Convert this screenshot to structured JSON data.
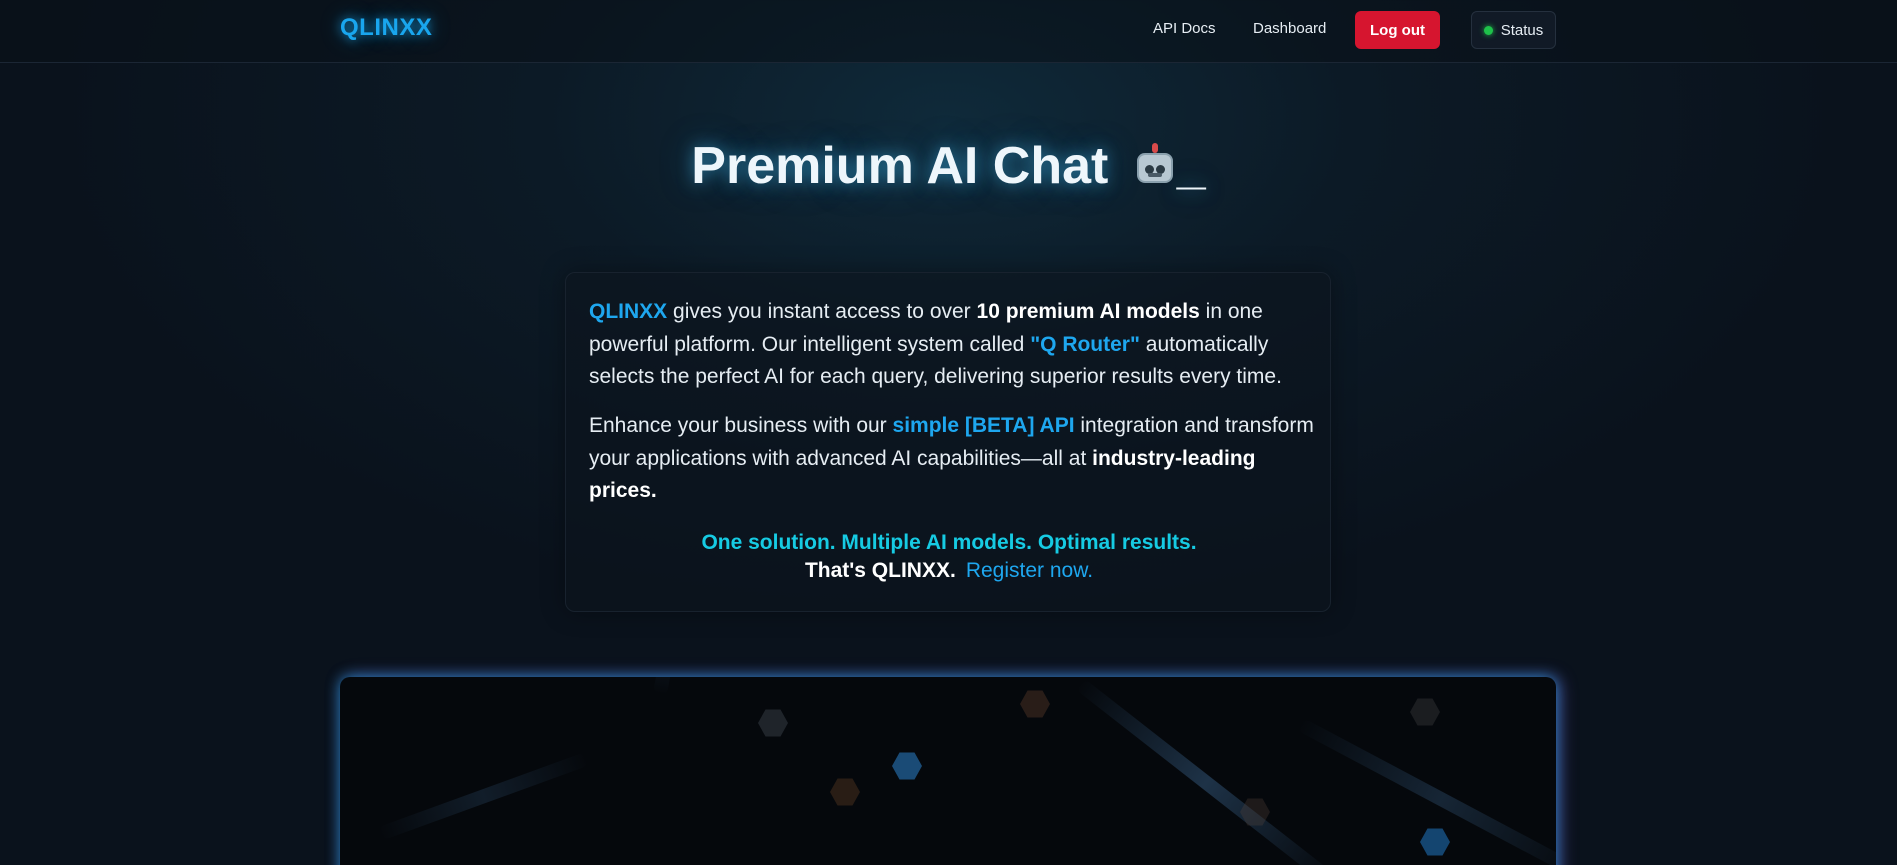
{
  "header": {
    "logo": "QLINXX",
    "nav": {
      "api_docs": "API Docs",
      "dashboard": "Dashboard",
      "logout": "Log out",
      "status": "Status"
    }
  },
  "hero": {
    "title": "Premium AI Chat",
    "title_suffix": "_",
    "icon": "robot-icon"
  },
  "card": {
    "p1": {
      "brand": "QLINXX",
      "t1": " gives you instant access to over ",
      "b1": "10 premium AI models",
      "t2": " in one powerful platform. Our intelligent system called ",
      "router": "\"Q Router\"",
      "t3": " automatically selects the perfect AI for each query, delivering superior results every time."
    },
    "p2": {
      "t1": "Enhance your business with our ",
      "api": "simple [BETA] API",
      "t2": " integration and transform your applications with advanced AI capabilities—all at ",
      "b1": "industry-leading prices",
      "t3": "."
    },
    "tagline": "One solution. Multiple AI models. Optimal results.",
    "tagline2": "That's QLINXX.",
    "register": "Register now."
  },
  "colors": {
    "accent": "#1ea7ef",
    "tagline": "#16cbe3",
    "logout": "#d6152f",
    "status_dot": "#1ec24a"
  }
}
